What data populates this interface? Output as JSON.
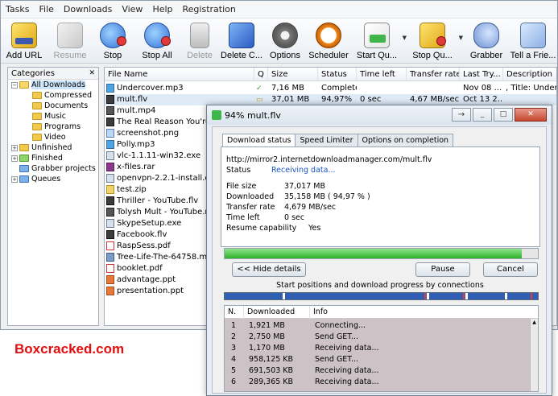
{
  "menu": [
    "Tasks",
    "File",
    "Downloads",
    "View",
    "Help",
    "Registration"
  ],
  "toolbar": [
    {
      "label": "Add URL",
      "icon": "add-url-icon",
      "disabled": false
    },
    {
      "label": "Resume",
      "icon": "resume-icon",
      "disabled": true
    },
    {
      "label": "Stop",
      "icon": "stop-icon",
      "disabled": false
    },
    {
      "label": "Stop All",
      "icon": "stop-all-icon",
      "disabled": false
    },
    {
      "label": "Delete",
      "icon": "delete-icon",
      "disabled": true
    },
    {
      "label": "Delete C...",
      "icon": "delete-completed-icon",
      "disabled": false
    },
    {
      "label": "Options",
      "icon": "options-icon",
      "disabled": false
    },
    {
      "label": "Scheduler",
      "icon": "scheduler-icon",
      "disabled": false
    },
    {
      "label": "Start Qu...",
      "icon": "start-queue-icon",
      "disabled": false
    },
    {
      "label": "Stop Qu...",
      "icon": "stop-queue-icon",
      "disabled": false
    },
    {
      "label": "Grabber",
      "icon": "grabber-icon",
      "disabled": false
    },
    {
      "label": "Tell a Frie...",
      "icon": "tell-a-friend-icon",
      "disabled": false
    }
  ],
  "categories": {
    "header": "Categories",
    "close": "✕",
    "items": [
      {
        "label": "All Downloads",
        "indent": 1,
        "expander": "−",
        "selected": true
      },
      {
        "label": "Compressed",
        "indent": 2
      },
      {
        "label": "Documents",
        "indent": 2
      },
      {
        "label": "Music",
        "indent": 2
      },
      {
        "label": "Programs",
        "indent": 2
      },
      {
        "label": "Video",
        "indent": 2
      },
      {
        "label": "Unfinished",
        "indent": 1,
        "expander": "+"
      },
      {
        "label": "Finished",
        "indent": 1,
        "expander": "+"
      },
      {
        "label": "Grabber projects",
        "indent": 1
      },
      {
        "label": "Queues",
        "indent": 1,
        "expander": "+"
      }
    ]
  },
  "file_list": {
    "columns": [
      "File Name",
      "Q",
      "Size",
      "Status",
      "Time left",
      "Transfer rate",
      "Last Try...",
      "Description"
    ],
    "rows": [
      {
        "name": "Undercover.mp3",
        "type": "mp3",
        "q": "✓",
        "size": "7,16  MB",
        "status": "Complete",
        "time_left": "",
        "rate": "",
        "last_try": "Nov 08 ...",
        "description": ", Title: Under"
      },
      {
        "name": "mult.flv",
        "type": "flv",
        "q": "▭",
        "size": "37,01  MB",
        "status": "94,97%",
        "time_left": "0 sec",
        "rate": "4,67  MB/sec",
        "last_try": "Oct 13 2...",
        "description": ""
      },
      {
        "name": "mult.mp4",
        "type": "mp4"
      },
      {
        "name": "The Real Reason You're Flat",
        "type": "flv"
      },
      {
        "name": "screenshot.png",
        "type": "png"
      },
      {
        "name": "Polly.mp3",
        "type": "mp3"
      },
      {
        "name": "vlc-1.1.11-win32.exe",
        "type": "exe"
      },
      {
        "name": "x-files.rar",
        "type": "rar"
      },
      {
        "name": "openvpn-2.2.1-install.exe",
        "type": "exe"
      },
      {
        "name": "test.zip",
        "type": "zip"
      },
      {
        "name": "Thriller - YouTube.flv",
        "type": "flv"
      },
      {
        "name": "Tolysh Mult - YouTube.mp4",
        "type": "mp4"
      },
      {
        "name": "SkypeSetup.exe",
        "type": "exe"
      },
      {
        "name": "Facebook.flv",
        "type": "flv"
      },
      {
        "name": "RaspSess.pdf",
        "type": "pdf"
      },
      {
        "name": "Tree-Life-The-64758.mov",
        "type": "mov"
      },
      {
        "name": "booklet.pdf",
        "type": "pdf"
      },
      {
        "name": "advantage.ppt",
        "type": "ppt"
      },
      {
        "name": "presentation.ppt",
        "type": "ppt"
      }
    ]
  },
  "dialog": {
    "title": "94% mult.flv",
    "tabs": [
      "Download status",
      "Speed Limiter",
      "Options on completion"
    ],
    "url": "http://mirror2.internetdownloadmanager.com/mult.flv",
    "status_label": "Status",
    "status_value": "Receiving data...",
    "fields": [
      {
        "label": "File size",
        "value": "37,017  MB"
      },
      {
        "label": "Downloaded",
        "value": "35,158  MB  ( 94,97 % )"
      },
      {
        "label": "Transfer rate",
        "value": "4,679  MB/sec"
      },
      {
        "label": "Time left",
        "value": "0 sec"
      },
      {
        "label": "Resume capability",
        "value": "Yes"
      }
    ],
    "progress": 0.9497,
    "buttons": {
      "hide_details": "<< Hide details",
      "pause": "Pause",
      "cancel": "Cancel"
    },
    "connections_caption": "Start positions and download progress by connections",
    "connection_columns": [
      "N.",
      "Downloaded",
      "Info"
    ],
    "connections": [
      {
        "n": "1",
        "downloaded": "1,921  MB",
        "info": "Connecting..."
      },
      {
        "n": "2",
        "downloaded": "2,750  MB",
        "info": "Send GET..."
      },
      {
        "n": "3",
        "downloaded": "1,170  MB",
        "info": "Receiving data..."
      },
      {
        "n": "4",
        "downloaded": "958,125  KB",
        "info": "Send GET..."
      },
      {
        "n": "5",
        "downloaded": "691,503  KB",
        "info": "Receiving data..."
      },
      {
        "n": "6",
        "downloaded": "289,365  KB",
        "info": "Receiving data..."
      }
    ]
  },
  "watermark": "Boxcracked.com",
  "colors": {
    "accent": "#1a55c6",
    "progress": "#2fb22b",
    "connections": "#2e5fb5",
    "watermark": "#e30d0d"
  }
}
